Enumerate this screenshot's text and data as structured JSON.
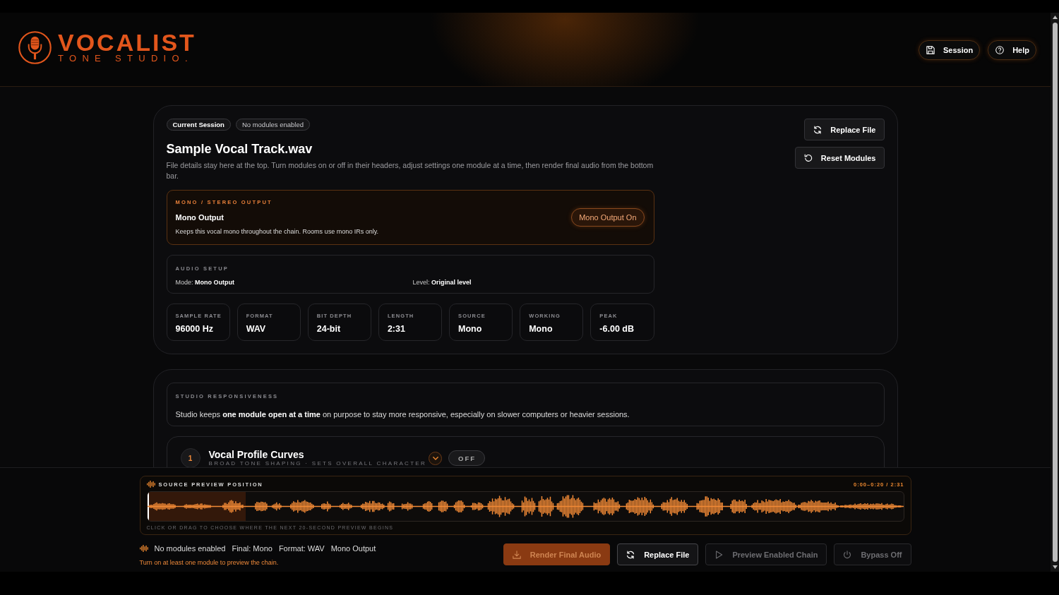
{
  "header": {
    "logo": {
      "title": "VOCALIST",
      "subtitle": "TONE STUDIO."
    },
    "buttons": [
      {
        "label": "Session"
      },
      {
        "label": "Help"
      }
    ]
  },
  "session": {
    "badges": [
      {
        "text": "Current Session",
        "kind": "label"
      },
      {
        "text": "No modules enabled",
        "kind": "status"
      }
    ],
    "title": "Sample Vocal Track.wav",
    "description": "File details stay here at the top. Turn modules on or off in their headers, adjust settings one module at a time, then render final audio from the bottom bar.",
    "actions": [
      {
        "label": "Replace File"
      },
      {
        "label": "Reset Modules"
      }
    ],
    "output": {
      "eyebrow": "MONO / STEREO OUTPUT",
      "title": "Mono Output",
      "description": "Keeps this vocal mono throughout the chain. Rooms use mono IRs only.",
      "toggle": {
        "label": "Mono Output On",
        "on": true
      }
    },
    "audio_setup": {
      "eyebrow": "AUDIO SETUP",
      "items": [
        "Mode: **Mono Output**",
        "Level: **Original level**"
      ]
    },
    "stats": [
      {
        "label": "SAMPLE RATE",
        "value": "96000 Hz"
      },
      {
        "label": "FORMAT",
        "value": "WAV"
      },
      {
        "label": "BIT DEPTH",
        "value": "24-bit"
      },
      {
        "label": "LENGTH",
        "value": "2:31"
      },
      {
        "label": "SOURCE",
        "value": "Mono"
      },
      {
        "label": "WORKING",
        "value": "Mono"
      },
      {
        "label": "PEAK",
        "value": "-6.00 dB"
      }
    ]
  },
  "modules_panel": {
    "notice": {
      "eyebrow": "STUDIO RESPONSIVENESS",
      "text": "Studio keeps **one module open at a time** on purpose to stay more responsive, especially on slower computers or heavier sessions."
    },
    "modules": [
      {
        "number": "1",
        "title": "Vocal Profile Curves",
        "subtitle": "BROAD TONE SHAPING · SETS OVERALL CHARACTER",
        "expanded": false,
        "toggle": {
          "label": "OFF",
          "on": false
        }
      }
    ]
  },
  "bottom_bar": {
    "preview": {
      "title": "SOURCE PREVIEW POSITION",
      "time": "0:00–0:20 / 2:31",
      "level": 0.13,
      "caption": "CLICK OR DRAG TO CHOOSE WHERE THE NEXT 20-SECOND PREVIEW BEGINS"
    },
    "status": [
      "No modules enabled",
      "Final: Mono",
      "Format: WAV",
      "Mono Output"
    ],
    "message": "Turn on at least one module to preview the chain.",
    "buttons": [
      {
        "label": "Render Final Audio",
        "kind": "primary",
        "disabled": true
      },
      {
        "label": "Replace File",
        "kind": "secondary",
        "disabled": false
      },
      {
        "label": "Preview Enabled Chain",
        "kind": "secondary",
        "disabled": true
      },
      {
        "label": "Bypass Off",
        "kind": "secondary",
        "disabled": true
      }
    ]
  }
}
